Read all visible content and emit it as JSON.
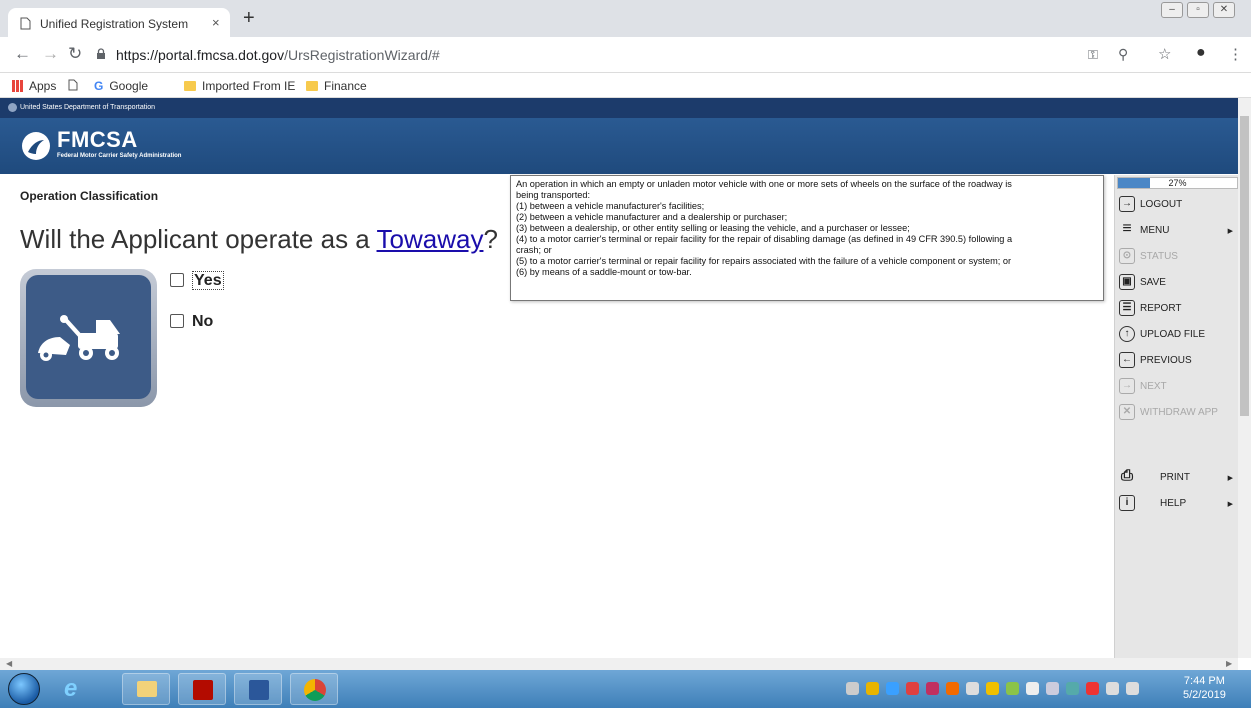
{
  "browser": {
    "tab_title": "Unified Registration System",
    "tab_close": "×",
    "new_tab": "+",
    "url_host": "https://portal.fmcsa.dot.gov",
    "url_path": "/UrsRegistrationWizard/#",
    "bookmarks": [
      "Apps",
      "Google",
      "Imported From IE",
      "Finance"
    ]
  },
  "header": {
    "dot_label": "United States Department of Transportation",
    "logo_title": "FMCSA",
    "logo_subtitle": "Federal Motor Carrier Safety Administration"
  },
  "main": {
    "section_title": "Operation Classification",
    "question_prefix": "Will the Applicant operate as a ",
    "question_link": "Towaway",
    "question_suffix": "?",
    "options": [
      {
        "label": "Yes",
        "checked": false
      },
      {
        "label": "No",
        "checked": false
      }
    ]
  },
  "tooltip": {
    "lines": [
      "An operation in which an empty or unladen motor vehicle with one or more sets of wheels on the surface of the roadway is",
      "being transported:",
      "(1) between a vehicle manufacturer's facilities;",
      "(2) between a vehicle manufacturer and a dealership or purchaser;",
      "(3) between a dealership, or other entity selling or leasing the vehicle, and a purchaser or lessee;",
      "(4) to a motor carrier's terminal or repair facility for the repair of disabling damage (as defined in 49 CFR 390.5) following a",
      "crash; or",
      "(5) to a motor carrier's terminal or repair facility for repairs associated with the failure of a vehicle component or system; or",
      "(6) by means of a saddle-mount or tow-bar."
    ]
  },
  "sidebar": {
    "progress_label": "27%",
    "progress_value": 0.27,
    "items": [
      {
        "label": "LOGOUT",
        "icon": "logout-icon",
        "glyph": "→",
        "disabled": false,
        "submenu": false
      },
      {
        "label": "MENU",
        "icon": "menu-icon",
        "glyph": "≡",
        "disabled": false,
        "submenu": true
      },
      {
        "label": "STATUS",
        "icon": "status-icon",
        "glyph": "⊙",
        "disabled": true,
        "submenu": false
      },
      {
        "label": "SAVE",
        "icon": "save-icon",
        "glyph": "▣",
        "disabled": false,
        "submenu": false
      },
      {
        "label": "REPORT",
        "icon": "report-icon",
        "glyph": "☰",
        "disabled": false,
        "submenu": false
      },
      {
        "label": "UPLOAD FILE",
        "icon": "upload-icon",
        "glyph": "↑",
        "disabled": false,
        "submenu": false
      },
      {
        "label": "PREVIOUS",
        "icon": "previous-icon",
        "glyph": "←",
        "disabled": false,
        "submenu": false
      },
      {
        "label": "NEXT",
        "icon": "next-icon",
        "glyph": "→",
        "disabled": true,
        "submenu": false
      },
      {
        "label": "WITHDRAW APP",
        "icon": "withdraw-icon",
        "glyph": "✕",
        "disabled": true,
        "submenu": false
      },
      {
        "label": "PRINT",
        "icon": "print-icon",
        "glyph": "⎙",
        "disabled": false,
        "submenu": true
      },
      {
        "label": "HELP",
        "icon": "help-icon",
        "glyph": "i",
        "disabled": false,
        "submenu": true
      }
    ]
  },
  "taskbar": {
    "time": "7:44 PM",
    "date": "5/2/2019"
  }
}
